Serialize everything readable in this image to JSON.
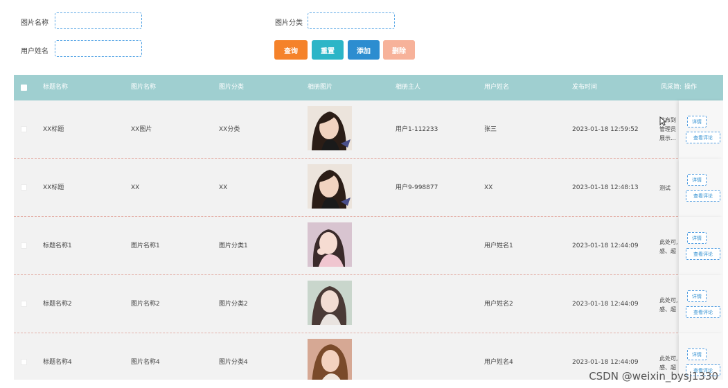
{
  "filters": {
    "image_name_label": "图片名称",
    "image_category_label": "图片分类",
    "user_name_label": "用户姓名",
    "image_name_value": "",
    "image_category_value": "",
    "user_name_value": ""
  },
  "buttons": {
    "query": "查询",
    "reset": "重置",
    "add": "添加",
    "delete": "删除"
  },
  "table": {
    "headers": [
      "标题名称",
      "图片名称",
      "图片分类",
      "相册图片",
      "相册主人",
      "用户姓名",
      "发布时间",
      "风采简介",
      "操作"
    ],
    "header_style_visible": "风采简:",
    "detail_label": "详情",
    "comment_label": "查看评论",
    "rows": [
      {
        "title": "XX标题",
        "image_name": "XX图片",
        "category": "XX分类",
        "owner": "用户1-112233",
        "user": "张三",
        "time": "2023-01-18 12:59:52",
        "style_lines": [
          "发布到",
          "管理员",
          "展示..."
        ]
      },
      {
        "title": "XX标题",
        "image_name": "XX",
        "category": "XX",
        "owner": "用户9-998877",
        "user": "XX",
        "time": "2023-01-18 12:48:13",
        "style_lines": [
          "测试"
        ]
      },
      {
        "title": "标题名称1",
        "image_name": "图片名称1",
        "category": "图片分类1",
        "owner": "",
        "user": "用户姓名1",
        "time": "2023-01-18 12:44:09",
        "style_lines": [
          "此处可,",
          "感、超"
        ]
      },
      {
        "title": "标题名称2",
        "image_name": "图片名称2",
        "category": "图片分类2",
        "owner": "",
        "user": "用户姓名2",
        "time": "2023-01-18 12:44:09",
        "style_lines": [
          "此处可,",
          "感、超"
        ]
      },
      {
        "title": "标题名称4",
        "image_name": "图片名称4",
        "category": "图片分类4",
        "owner": "",
        "user": "用户姓名4",
        "time": "2023-01-18 12:44:09",
        "style_lines": [
          "此处可,",
          "感、超"
        ]
      }
    ]
  },
  "watermark": "CSDN @weixin_bysj1330",
  "colors": {
    "header_bg": "#9fcfd0",
    "query": "#f5822a",
    "reset": "#2cb5c7",
    "add": "#2c8dd0",
    "delete": "#f7b29a"
  }
}
